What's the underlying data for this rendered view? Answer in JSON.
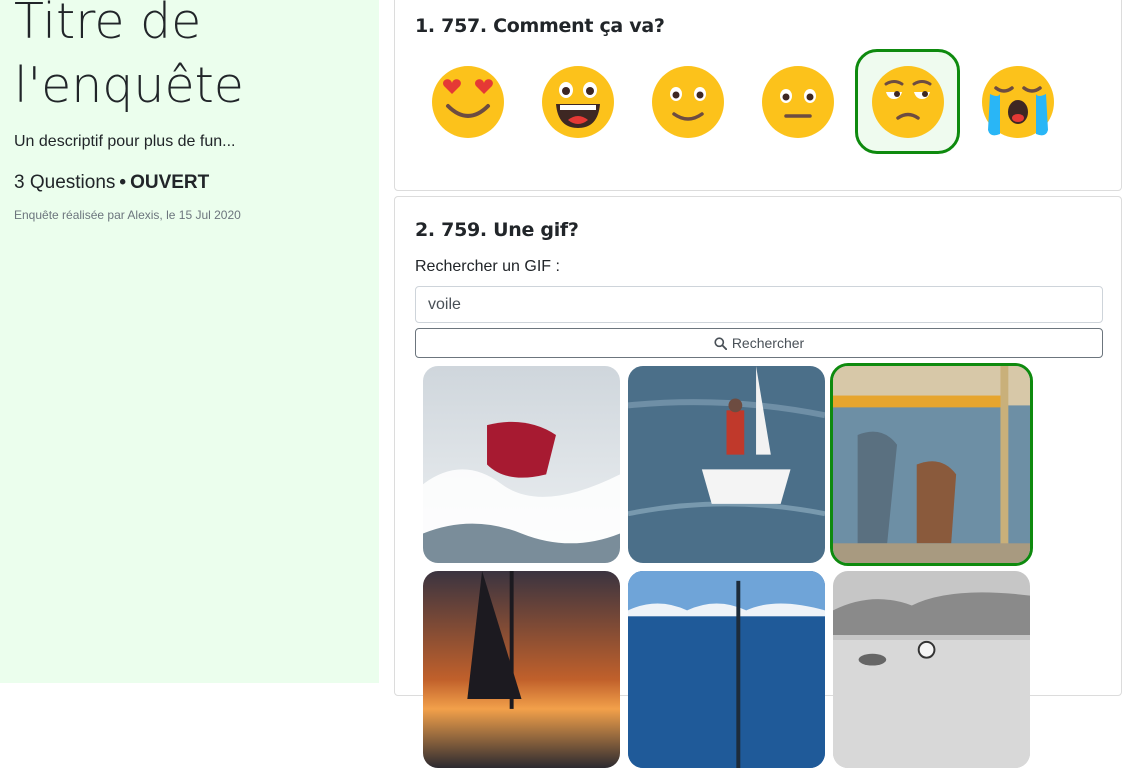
{
  "survey": {
    "title": "Titre de l'enquête",
    "description": "Un descriptif pour plus de fun...",
    "questions_count": "3 Questions",
    "separator": "•",
    "status": "OUVERT",
    "author_line": "Enquête réalisée par Alexis, le 15 Jul 2020"
  },
  "question1": {
    "title": "1. 757. Comment ça va?",
    "options": [
      {
        "icon": "heart-eyes-emoji-icon",
        "selected": false
      },
      {
        "icon": "grinning-emoji-icon",
        "selected": false
      },
      {
        "icon": "slight-smile-emoji-icon",
        "selected": false
      },
      {
        "icon": "neutral-face-emoji-icon",
        "selected": false
      },
      {
        "icon": "unamused-face-emoji-icon",
        "selected": true
      },
      {
        "icon": "crying-face-emoji-icon",
        "selected": false
      }
    ]
  },
  "question2": {
    "title": "2. 759. Une gif?",
    "search_label": "Rechercher un GIF :",
    "search_value": "voile",
    "search_button": "Rechercher",
    "gifs": [
      {
        "name": "gif-ship-storm",
        "selected": false
      },
      {
        "name": "gif-sailor-dinghy",
        "selected": false
      },
      {
        "name": "gif-boat-deck",
        "selected": true
      },
      {
        "name": "gif-sunset-sailboat",
        "selected": false
      },
      {
        "name": "gif-sea-mast",
        "selected": false
      },
      {
        "name": "gif-cartoon-coast",
        "selected": false
      }
    ]
  },
  "colors": {
    "sidebar_bg": "#ebfeed",
    "selected_border": "#0e8a0e"
  }
}
